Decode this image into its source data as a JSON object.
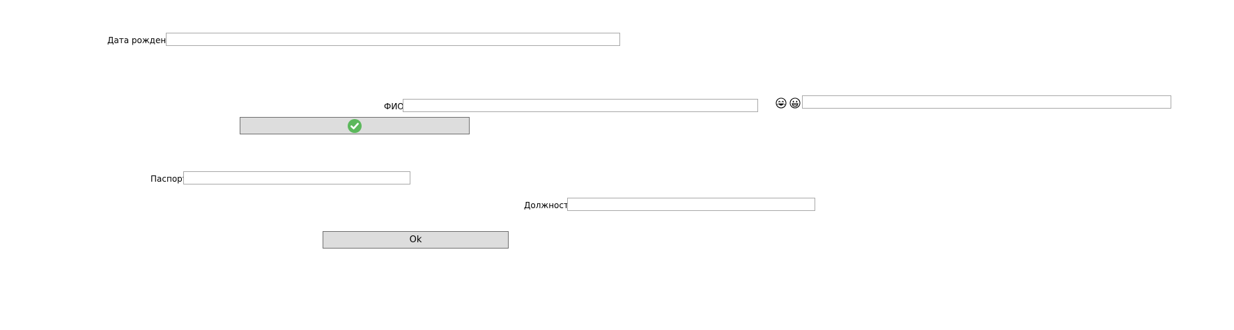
{
  "form": {
    "birth_date": {
      "label": "Дата рождения",
      "value": ""
    },
    "full_name": {
      "label": "ФИО",
      "value": ""
    },
    "emoji_field": {
      "value": ""
    },
    "passport": {
      "label": "Паспорт",
      "value": ""
    },
    "position": {
      "label": "Должность",
      "value": ""
    },
    "ok_button": {
      "label": "Ok"
    }
  },
  "icons": {
    "confirm": "check-circle-icon",
    "emoji_1": "laughing-face-icon",
    "emoji_2": "grinning-face-icon"
  },
  "colors": {
    "button_bg": "#dddddd",
    "field_border": "#a9a9a9",
    "check_green": "#5cb85c"
  }
}
